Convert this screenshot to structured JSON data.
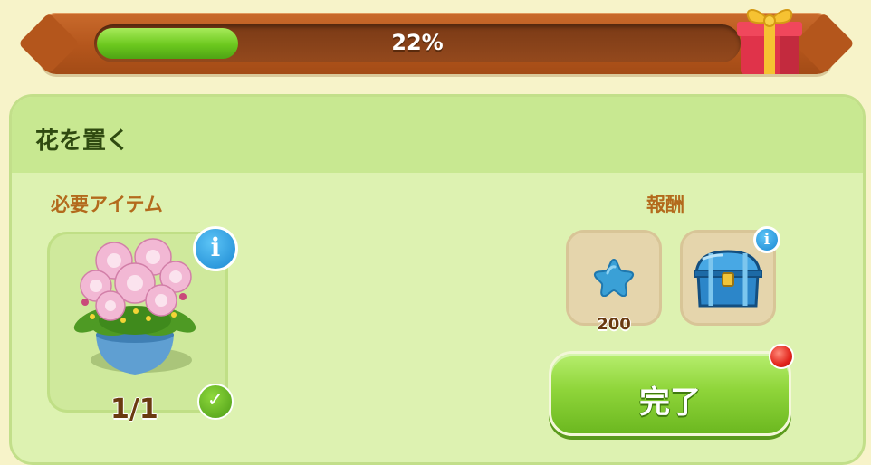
{
  "progress": {
    "percent_text": "22%",
    "fraction": 0.22
  },
  "quest": {
    "title": "花を置く"
  },
  "required": {
    "label": "必要アイテム",
    "item_icon": "flower-pot-icon",
    "count": "1/1",
    "info_icon": "i"
  },
  "rewards": {
    "label": "報酬",
    "items": [
      {
        "icon": "blue-star-icon",
        "amount": "200"
      },
      {
        "icon": "treasure-chest-icon",
        "info_icon": "i"
      }
    ]
  },
  "buttons": {
    "complete": "完了"
  },
  "colors": {
    "accent_green": "#6cc81e",
    "frame_brown": "#b4561c",
    "panel_green": "#ddf2b1"
  }
}
